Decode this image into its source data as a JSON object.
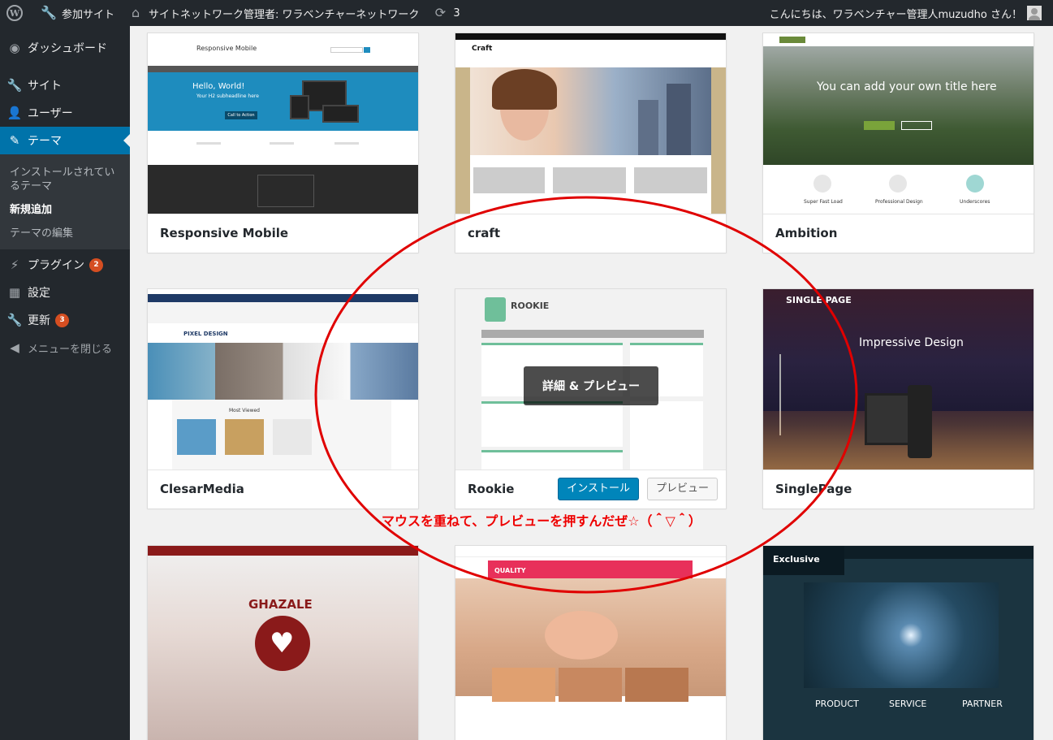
{
  "adminbar": {
    "wp_logo": "wordpress-logo",
    "my_sites": "参加サイト",
    "network_admin": "サイトネットワーク管理者: ワラベンチャーネットワーク",
    "updates_count": "3",
    "greeting": "こんにちは、ワラベンチャー管理人muzudho さん！"
  },
  "menu": {
    "dashboard": "ダッシュボード",
    "sites": "サイト",
    "users": "ユーザー",
    "themes": "テーマ",
    "sub_installed": "インストールされているテーマ",
    "sub_add_new": "新規追加",
    "sub_editor": "テーマの編集",
    "plugins": "プラグイン",
    "plugins_badge": "2",
    "settings": "設定",
    "updates": "更新",
    "updates_badge": "3",
    "collapse": "メニューを閉じる"
  },
  "themes": [
    {
      "name": "Responsive Mobile"
    },
    {
      "name": "craft"
    },
    {
      "name": "Ambition"
    },
    {
      "name": "ClesarMedia"
    },
    {
      "name": "Rookie"
    },
    {
      "name": "SinglePage"
    },
    {
      "name": ""
    },
    {
      "name": ""
    },
    {
      "name": ""
    }
  ],
  "shots": {
    "rm_title": "Responsive Mobile",
    "rm_hello": "Hello, World!",
    "rm_sub": "Your H2 subheadline here",
    "rm_cta": "Call to Action",
    "craft_logo": "Craft",
    "amb_title": "You can add your own title here",
    "amb_f1": "Super Fast Load",
    "amb_f2": "Professional Design",
    "amb_f3": "Underscores",
    "pixel": "PIXEL DESIGN",
    "most_viewed": "Most Viewed",
    "rookie": "ROOKIE",
    "single_page": "SINGLE PAGE",
    "impressive": "Impressive Design",
    "ghazale": "GHAZALE",
    "quality": "QUALITY",
    "exclusive": "Exclusive",
    "product": "PRODUCT",
    "service": "SERVICE",
    "partner": "PARTNER"
  },
  "rookie_actions": {
    "details_preview": "詳細 & プレビュー",
    "install": "インストール",
    "preview": "プレビュー"
  },
  "annotation": {
    "text": "マウスを重ねて、プレビューを押すんだぜ☆（＾▽＾）",
    "color": "#e00000"
  },
  "colors": {
    "menu_bg": "#23282d",
    "menu_active": "#0073aa",
    "install_button": "#0085ba",
    "badge": "#d54e21"
  }
}
